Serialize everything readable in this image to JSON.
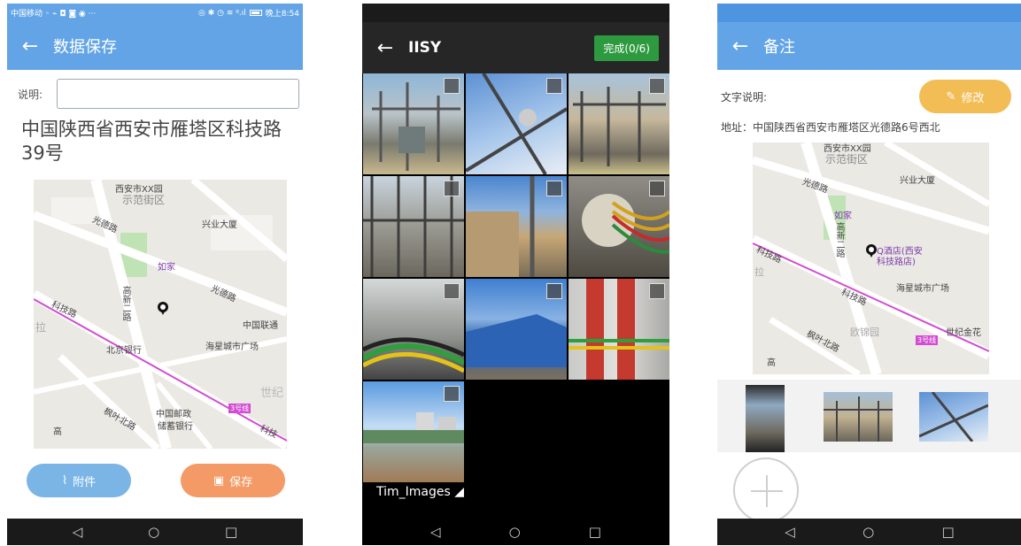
{
  "panel1": {
    "status": {
      "carrier": "中国移动",
      "icons_left": "◦ ⌁ ◘ ◙ ◉ ···",
      "icons_right": "◎ ✱ ◷ ≋ ᵍ.ıl",
      "time": "晚上8:54"
    },
    "appbar": {
      "back": "←",
      "title": "数据保存"
    },
    "desc_label": "说明:",
    "desc_value": "",
    "address": "中国陕西省西安市雁塔区科技路39号",
    "map": {
      "labels": [
        "西安市XX园",
        "示范街区",
        "兴业大厦",
        "光德路",
        "如家",
        "高新二路",
        "光德路",
        "中国联通",
        "科技路",
        "拉",
        "北京银行",
        "海星城市广场",
        "世纪",
        "中国邮政",
        "储蓄银行",
        "3号线",
        "枫叶北路",
        "科技",
        "高"
      ],
      "road_color": "#d24bd2"
    },
    "btn_attach": "附件",
    "btn_save": "保存",
    "colors": {
      "appbar": "#63a4e6",
      "attach": "#7ab5e6",
      "save": "#f39a66"
    }
  },
  "panel2": {
    "appbar": {
      "back": "←",
      "title": "IISY",
      "done": "完成(0/6)"
    },
    "thumbs": [
      "photo-substation-1",
      "photo-insulator-sky",
      "photo-substation-2",
      "photo-substation-3",
      "photo-building-pole",
      "photo-transformer-cables",
      "photo-cable-bundle",
      "photo-blue-building",
      "photo-switchgear",
      "photo-construction-site"
    ],
    "album": "Tim_Images ◢",
    "colors": {
      "done": "#2e9a3f"
    }
  },
  "panel3": {
    "appbar": {
      "back": "←",
      "title": "备注"
    },
    "text_label": "文字说明:",
    "edit_label": "修改",
    "address": "地址：中国陕西省西安市雁塔区光德路6号西北",
    "map": {
      "labels": [
        "西安市XX园",
        "示范街区",
        "兴业大厦",
        "光德路",
        "如家",
        "高新二路",
        "Q酒店(西安",
        "科技路店)",
        "科技路",
        "拉",
        "海星城市广场",
        "科技路",
        "欧锦园",
        "世纪金花",
        "枫叶北路",
        "3号线",
        "高"
      ]
    },
    "strip_thumbs": [
      "screenshot-thumb",
      "photo-substation-thumb",
      "photo-insulator-thumb"
    ],
    "colors": {
      "edit": "#f2bd55"
    }
  },
  "nav": {
    "back": "◁",
    "home": "○",
    "recent": "□"
  }
}
